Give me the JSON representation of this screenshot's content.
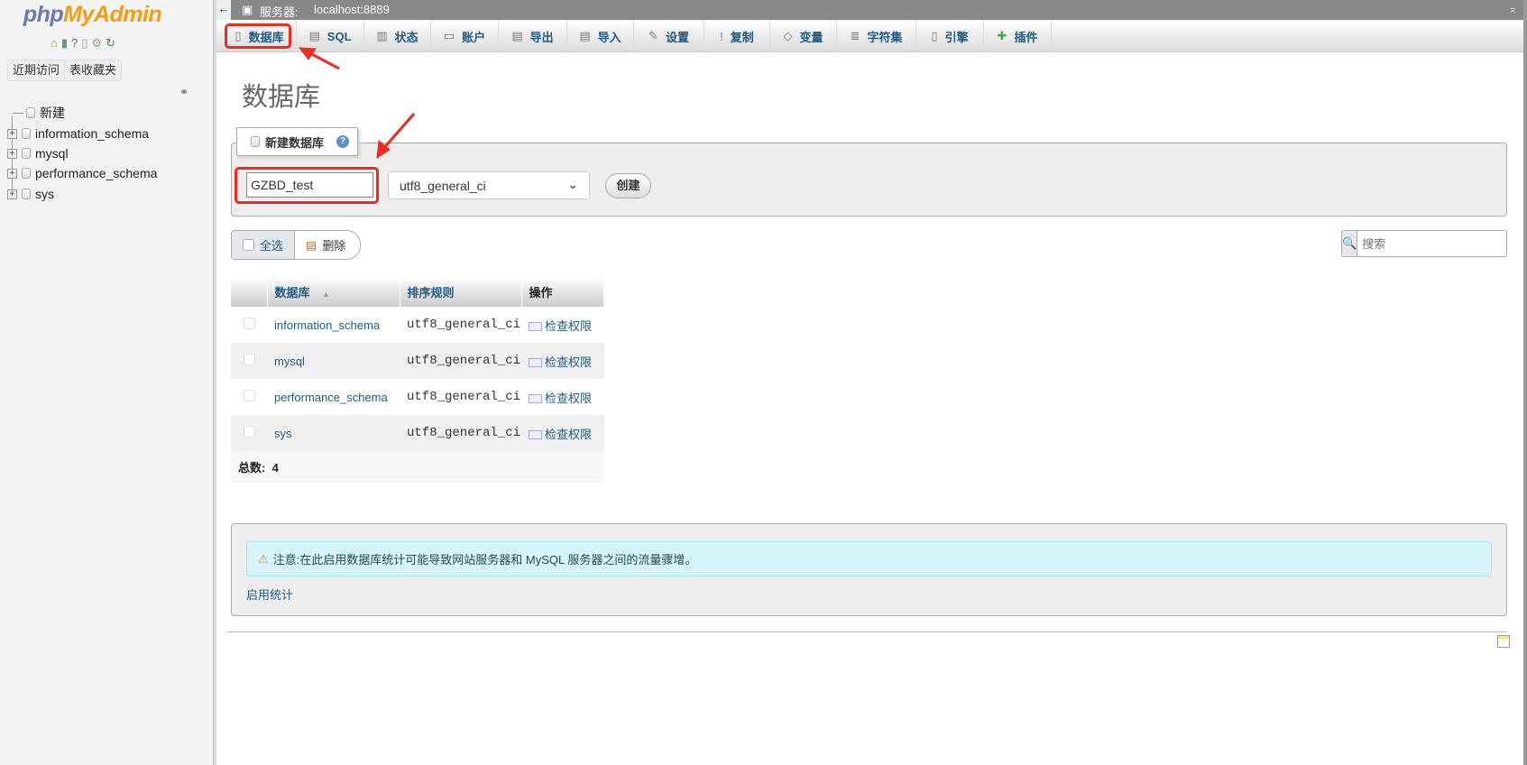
{
  "sidebar": {
    "logo_php": "php",
    "logo_myadmin": "MyAdmin",
    "recent": "近期访问",
    "favorites": "表收藏夹",
    "tree": [
      {
        "label": "新建"
      },
      {
        "label": "information_schema"
      },
      {
        "label": "mysql"
      },
      {
        "label": "performance_schema"
      },
      {
        "label": "sys"
      }
    ]
  },
  "topbar": {
    "server_label": "服务器:",
    "server": "localhost:8889"
  },
  "tabs": [
    {
      "label": "数据库",
      "icon": "database-icon"
    },
    {
      "label": "SQL",
      "icon": "sql-icon"
    },
    {
      "label": "状态",
      "icon": "status-icon"
    },
    {
      "label": "账户",
      "icon": "users-icon"
    },
    {
      "label": "导出",
      "icon": "export-icon"
    },
    {
      "label": "导入",
      "icon": "import-icon"
    },
    {
      "label": "设置",
      "icon": "settings-icon"
    },
    {
      "label": "复制",
      "icon": "replication-icon"
    },
    {
      "label": "变量",
      "icon": "variables-icon"
    },
    {
      "label": "字符集",
      "icon": "charset-icon"
    },
    {
      "label": "引擎",
      "icon": "engine-icon"
    },
    {
      "label": "插件",
      "icon": "plugin-icon"
    }
  ],
  "page": {
    "title": "数据库"
  },
  "create": {
    "legend": "新建数据库",
    "name_value": "GZBD_test",
    "collation": "utf8_general_ci",
    "create_label": "创建"
  },
  "bulk": {
    "select_all": "全选",
    "delete": "删除"
  },
  "search": {
    "placeholder": "搜索"
  },
  "table": {
    "headers": [
      "数据库",
      "排序规则",
      "操作"
    ],
    "rows": [
      {
        "name": "information_schema",
        "collation": "utf8_general_ci",
        "action": "检查权限"
      },
      {
        "name": "mysql",
        "collation": "utf8_general_ci",
        "action": "检查权限"
      },
      {
        "name": "performance_schema",
        "collation": "utf8_general_ci",
        "action": "检查权限"
      },
      {
        "name": "sys",
        "collation": "utf8_general_ci",
        "action": "检查权限"
      }
    ],
    "total_label": "总数:",
    "total": "4"
  },
  "notice": {
    "text": "注意:在此启用数据库统计可能导致网站服务器和 MySQL 服务器之间的流量骤增。",
    "enable_stats": "启用统计"
  },
  "colors": {
    "link": "#235a81",
    "highlight": "#ee2b1e",
    "notice_bg": "#d7f4fa"
  }
}
